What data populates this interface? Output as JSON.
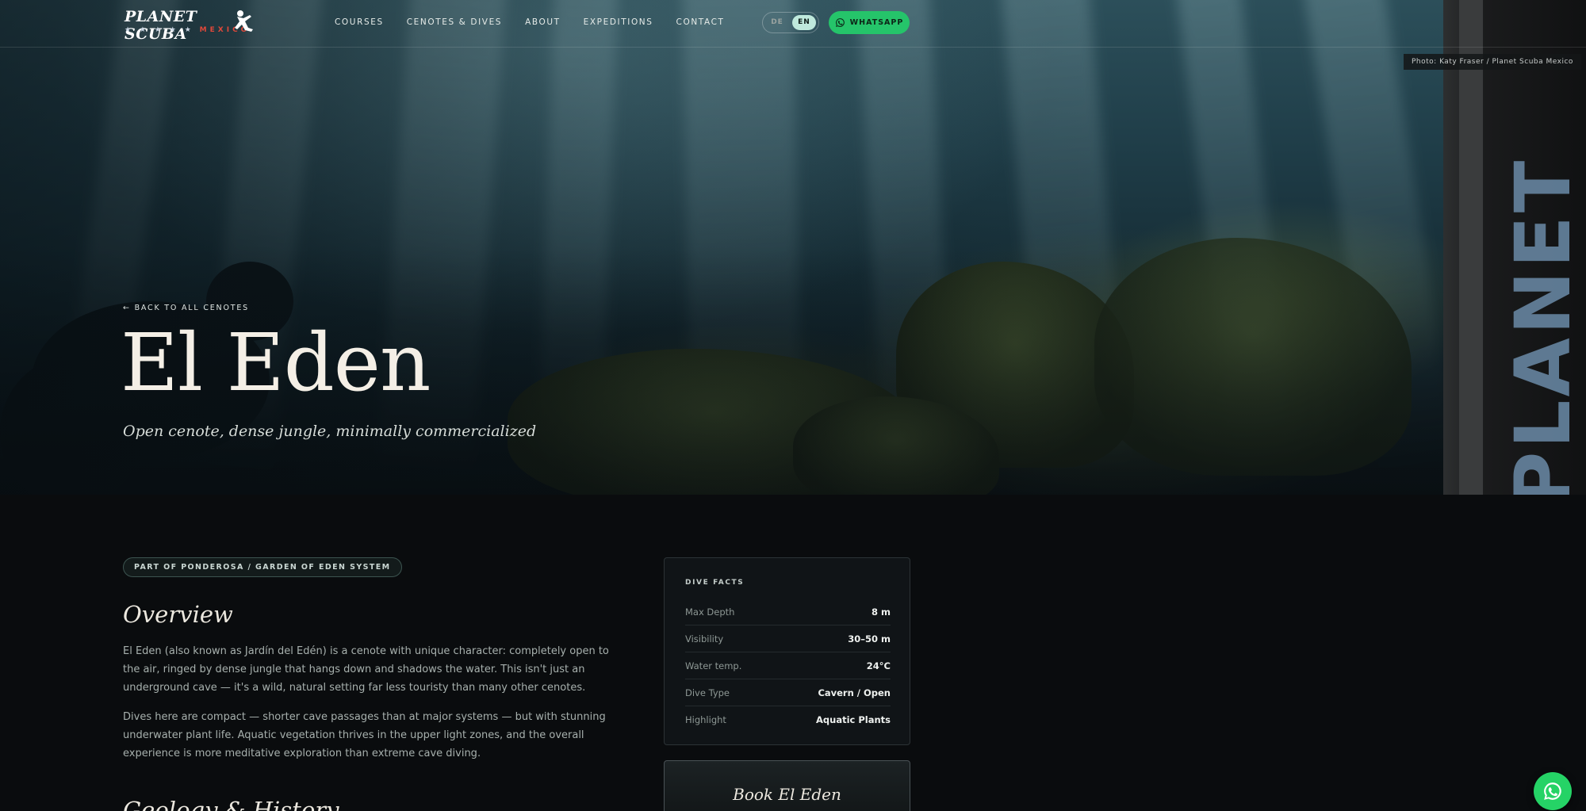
{
  "brand": {
    "logo_text": "PLANET SCUBA",
    "logo_stars": "★ ★ ★ ★ ★",
    "logo_sub": "MEXICO"
  },
  "nav": {
    "links": [
      "COURSES",
      "CENOTES & DIVES",
      "ABOUT",
      "EXPEDITIONS",
      "CONTACT"
    ],
    "lang_de": "DE",
    "lang_en": "EN",
    "lang_active": "EN",
    "whatsapp_label": "WHATSAPP",
    "whatsapp_icon": "whatsapp-icon"
  },
  "hero": {
    "photo_credit": "Photo: Katy Fraser / Planet Scuba Mexico",
    "back_link": "← BACK TO ALL CENOTES",
    "title": "El Eden",
    "subtitle": "Open cenote, dense jungle, minimally commercialized",
    "side_text": "PLANET SCUBA"
  },
  "content": {
    "badge": "PART OF PONDEROSA / GARDEN OF EDEN SYSTEM",
    "overview_heading": "Overview",
    "paragraphs": [
      "El Eden (also known as Jardín del Edén) is a cenote with unique character: completely open to the air, ringed by dense jungle that hangs down and shadows the water. This isn't just an underground cave — it's a wild, natural setting far less touristy than many other cenotes.",
      "Dives here are compact — shorter cave passages than at major systems — but with stunning underwater plant life. Aquatic vegetation thrives in the upper light zones, and the overall experience is more meditative exploration than extreme cave diving."
    ],
    "geology_heading": "Geology & History"
  },
  "facts": {
    "title": "DIVE FACTS",
    "rows": [
      {
        "label": "Max Depth",
        "value": "8 m"
      },
      {
        "label": "Visibility",
        "value": "30–50 m"
      },
      {
        "label": "Water temp.",
        "value": "24°C"
      },
      {
        "label": "Dive Type",
        "value": "Cavern / Open"
      },
      {
        "label": "Highlight",
        "value": "Aquatic Plants"
      }
    ]
  },
  "booking": {
    "title": "Book El Eden"
  },
  "colors": {
    "accent_green": "#25d366",
    "lang_active_bg": "#bfe9dc",
    "background": "#0a0c0e"
  }
}
